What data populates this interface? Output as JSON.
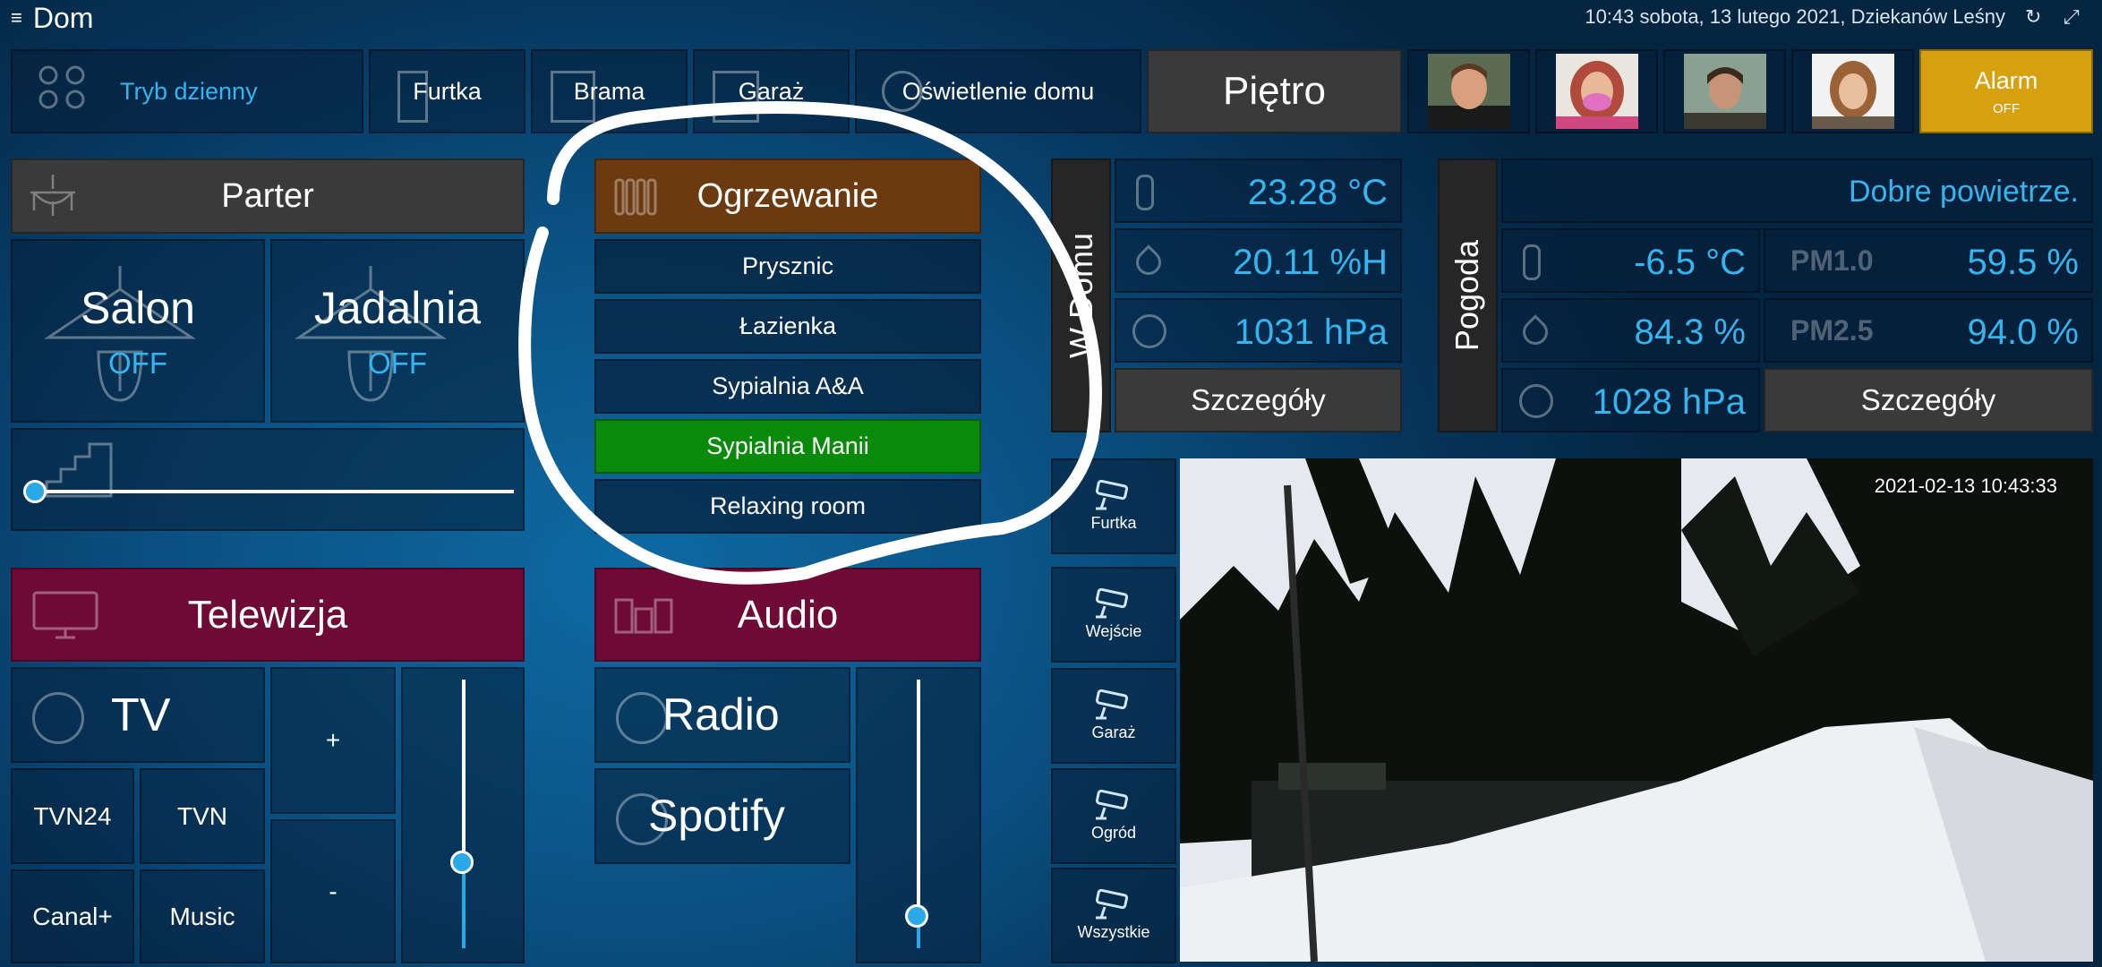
{
  "header": {
    "title": "Dom",
    "datetime": "10:43 sobota, 13 lutego 2021, Dziekanów Leśny"
  },
  "topbar": {
    "day_mode": "Tryb dzienny",
    "furtka": "Furtka",
    "brama": "Brama",
    "garaz": "Garaż",
    "lights": "Oświetlenie domu",
    "floor": "Piętro",
    "alarm": "Alarm",
    "alarm_state": "OFF"
  },
  "parter": {
    "title": "Parter",
    "salon": "Salon",
    "salon_state": "OFF",
    "jadalnia": "Jadalnia",
    "jadalnia_state": "OFF",
    "blinds_level": 0
  },
  "heating": {
    "title": "Ogrzewanie",
    "items": [
      "Prysznic",
      "Łazienka",
      "Sypialnia A&A",
      "Sypialnia Manii",
      "Relaxing room"
    ]
  },
  "home": {
    "label": "W Domu",
    "temp": "23.28 °C",
    "humidity": "20.11 %H",
    "pressure": "1031 hPa",
    "details": "Szczegóły"
  },
  "weather": {
    "label": "Pogoda",
    "air": "Dobre powietrze.",
    "temp": "-6.5 °C",
    "humidity": "84.3 %",
    "pressure": "1028 hPa",
    "pm1_label": "PM1.0",
    "pm1": "59.5 %",
    "pm25_label": "PM2.5",
    "pm25": "94.0 %",
    "details": "Szczegóły"
  },
  "tv": {
    "title": "Telewizja",
    "tv": "TV",
    "ch1": "TVN24",
    "ch2": "TVN",
    "ch3": "Canal+",
    "ch4": "Music",
    "plus": "+",
    "minus": "-",
    "volume_level": 0.32
  },
  "audio": {
    "title": "Audio",
    "radio": "Radio",
    "spotify": "Spotify",
    "volume_level": 0.12
  },
  "cameras": {
    "items": [
      "Furtka",
      "Wejście",
      "Garaż",
      "Ogród",
      "Wszystkie"
    ],
    "timestamp": "2021-02-13 10:43:33"
  },
  "colors": {
    "accent": "#33b5f0",
    "heating": "#6b3a10",
    "active": "#0a8a0a",
    "media": "#6e0a35",
    "alarm": "#d7a00e"
  }
}
